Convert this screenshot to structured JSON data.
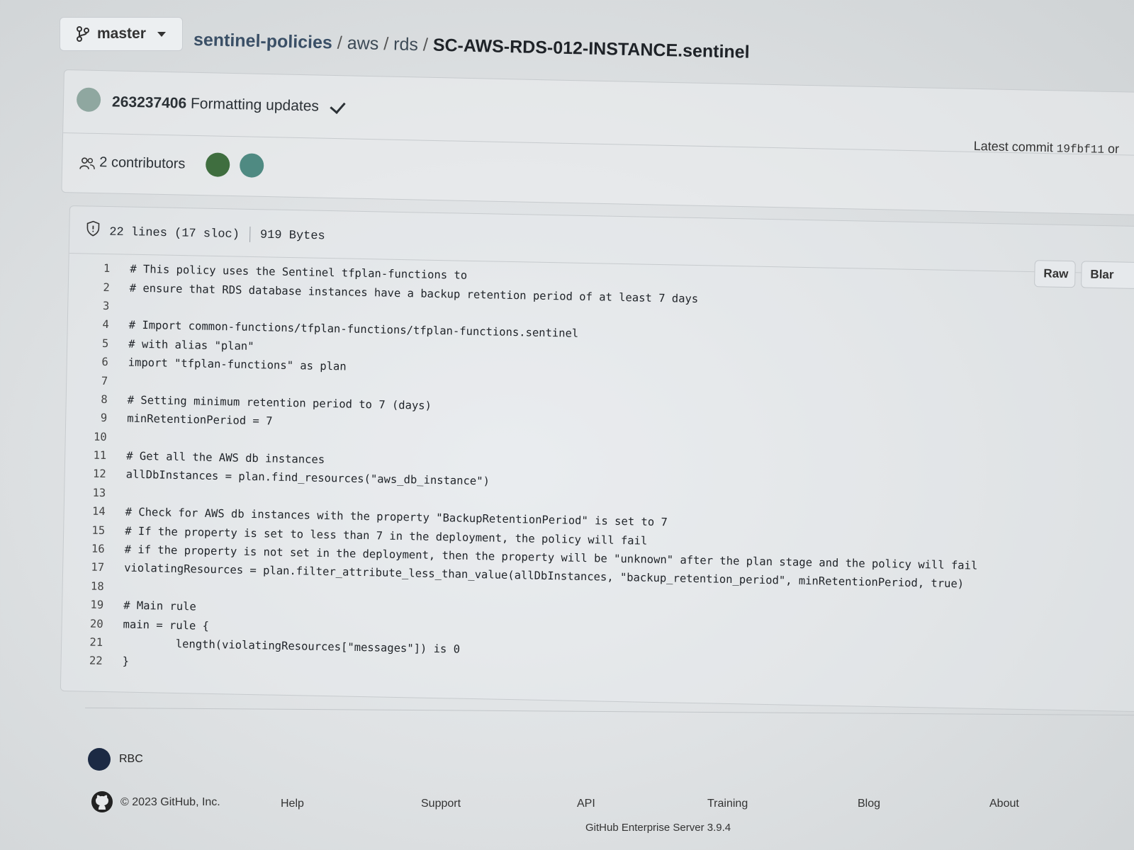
{
  "branch": {
    "label": "master"
  },
  "breadcrumb": {
    "repo": "sentinel-policies",
    "sep1": "/",
    "dir1": "aws",
    "sep2": "/",
    "dir2": "rds",
    "sep3": "/",
    "file": "SC-AWS-RDS-012-INSTANCE.sentinel"
  },
  "commit": {
    "author": "263237406",
    "message": "Formatting updates",
    "latest_label": "Latest commit",
    "latest_sha": "19fbf11",
    "latest_suffix": "or"
  },
  "contributors": {
    "text": "2 contributors"
  },
  "file": {
    "lines_info": "22 lines (17 sloc)",
    "size": "919 Bytes",
    "raw_label": "Raw",
    "blame_label": "Blar"
  },
  "code": [
    "# This policy uses the Sentinel tfplan-functions to",
    "# ensure that RDS database instances have a backup retention period of at least 7 days",
    "",
    "# Import common-functions/tfplan-functions/tfplan-functions.sentinel",
    "# with alias \"plan\"",
    "import \"tfplan-functions\" as plan",
    "",
    "# Setting minimum retention period to 7 (days)",
    "minRetentionPeriod = 7",
    "",
    "# Get all the AWS db instances",
    "allDbInstances = plan.find_resources(\"aws_db_instance\")",
    "",
    "# Check for AWS db instances with the property \"BackupRetentionPeriod\" is set to 7",
    "# If the property is set to less than 7 in the deployment, the policy will fail",
    "# if the property is not set in the deployment, then the property will be \"unknown\" after the plan stage and the policy will fail",
    "violatingResources = plan.filter_attribute_less_than_value(allDbInstances, \"backup_retention_period\", minRetentionPeriod, true)",
    "",
    "# Main rule",
    "main = rule {",
    "        length(violatingResources[\"messages\"]) is 0",
    "}"
  ],
  "org": {
    "name": "RBC"
  },
  "footer": {
    "copyright": "© 2023 GitHub, Inc.",
    "links": [
      "Help",
      "Support",
      "API",
      "Training",
      "Blog",
      "About"
    ],
    "enterprise": "GitHub Enterprise Server 3.9.4"
  }
}
